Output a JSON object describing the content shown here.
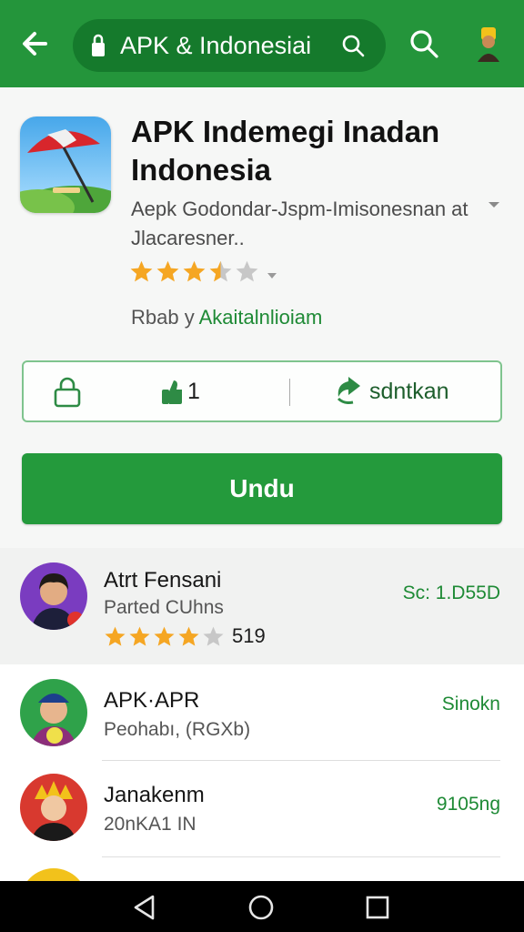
{
  "toolbar": {
    "search_text": "APK & Indonesiai",
    "back_icon": "arrow-left-icon",
    "search_icon": "search-icon",
    "profile_icon": "avatar-icon"
  },
  "app": {
    "title": "APK Indemegi Inadan Indonesia",
    "developer": "Aepk Godondar-Jspm-Imisonesnan at Jlacaresner..",
    "rating_stars": 3.5,
    "rating_max": 5,
    "category_prefix": "Rbab y",
    "category_link": "Akaitalnlioiam"
  },
  "info_card": {
    "count": "1",
    "share_label": "sdntkan"
  },
  "download_button": {
    "label": "Undu"
  },
  "review": {
    "name": "Atrt Fensani",
    "subtitle": "Parted CUhns",
    "stars": 4,
    "count": "519",
    "right_text": "Sc: 1.D55D"
  },
  "list": [
    {
      "title": "APK·APR",
      "subtitle": "Peohabı, (RGXb)",
      "right_text": "Sinokn"
    },
    {
      "title": "Janakenm",
      "subtitle": "20nKA1  IN",
      "right_text": "9105ng"
    }
  ],
  "colors": {
    "brand_green": "#24953b",
    "dark_green": "#157a2c",
    "star_gold": "#f5a623",
    "star_gray": "#c7c7c7"
  }
}
